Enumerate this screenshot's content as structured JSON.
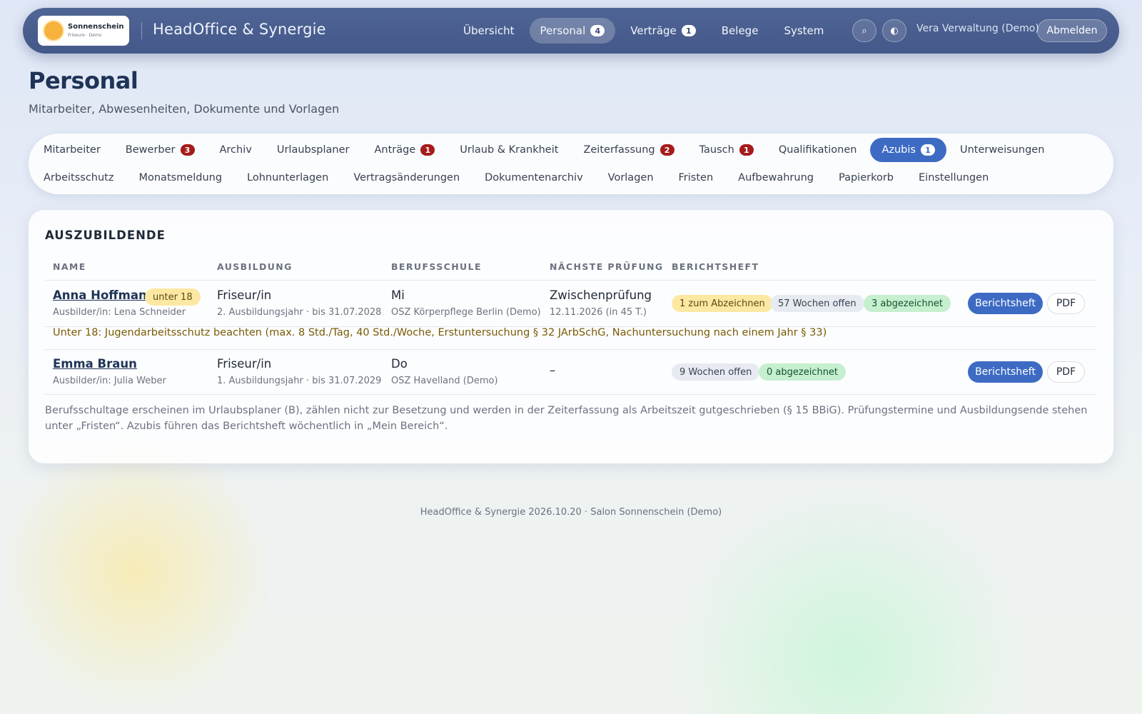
{
  "header": {
    "logo_name": "Sonnenschein",
    "logo_sub": "Friseure · Demo",
    "app_title": "HeadOffice & Synergie",
    "nav": [
      {
        "label": "Übersicht",
        "badge": ""
      },
      {
        "label": "Personal",
        "badge": "4",
        "active": true
      },
      {
        "label": "Verträge",
        "badge": "1"
      },
      {
        "label": "Belege",
        "badge": ""
      },
      {
        "label": "System",
        "badge": ""
      }
    ],
    "search_icon": "⌕",
    "theme_icon": "◐",
    "user": "Vera Verwaltung (Demo)",
    "logout_label": "Abmelden"
  },
  "page": {
    "title": "Personal",
    "subtitle": "Mitarbeiter, Abwesenheiten, Dokumente und Vorlagen"
  },
  "tabs": {
    "row1": [
      {
        "label": "Mitarbeiter",
        "badge": ""
      },
      {
        "label": "Bewerber",
        "badge": "3"
      },
      {
        "label": "Archiv",
        "badge": ""
      },
      {
        "label": "Urlaubsplaner",
        "badge": ""
      },
      {
        "label": "Anträge",
        "badge": "1"
      },
      {
        "label": "Urlaub & Krankheit",
        "badge": ""
      },
      {
        "label": "Zeiterfassung",
        "badge": "2"
      },
      {
        "label": "Tausch",
        "badge": "1"
      },
      {
        "label": "Qualifikationen",
        "badge": ""
      },
      {
        "label": "Azubis",
        "badge": "1",
        "active": true
      },
      {
        "label": "Unterweisungen",
        "badge": ""
      }
    ],
    "row2": [
      {
        "label": "Arbeitsschutz"
      },
      {
        "label": "Monatsmeldung"
      },
      {
        "label": "Lohnunterlagen"
      },
      {
        "label": "Vertragsänderungen"
      },
      {
        "label": "Dokumentenarchiv"
      },
      {
        "label": "Vorlagen"
      },
      {
        "label": "Fristen"
      },
      {
        "label": "Aufbewahrung"
      },
      {
        "label": "Papierkorb"
      },
      {
        "label": "Einstellungen"
      }
    ]
  },
  "card": {
    "title": "AUSZUBILDENDE",
    "columns": [
      "NAME",
      "AUSBILDUNG",
      "BERUFSSCHULE",
      "NÄCHSTE PRÜFUNG",
      "BERICHTSHEFT"
    ],
    "rows": [
      {
        "name": "Anna Hoffmann",
        "age_badge": "unter 18",
        "trainer": "Ausbilder/in: Lena Schneider",
        "training": "Friseur/in",
        "training_sub": "2. Ausbildungsjahr · bis 31.07.2028",
        "school_day": "Mi",
        "school": "OSZ Körperpflege Berlin (Demo)",
        "exam": "Zwischenprüfung",
        "exam_sub": "12.11.2026 (in 45 T.)",
        "pill_sign": "1 zum Abzeichnen",
        "pill_open": "57 Wochen offen",
        "pill_signed": "3 abgezeichnet",
        "btn_report": "Berichtsheft",
        "btn_pdf": "PDF"
      },
      {
        "name": "Emma Braun",
        "trainer": "Ausbilder/in: Julia Weber",
        "training": "Friseur/in",
        "training_sub": "1. Ausbildungsjahr · bis 31.07.2029",
        "school_day": "Do",
        "school": "OSZ Havelland (Demo)",
        "exam": "–",
        "pill_open": "9 Wochen offen",
        "pill_signed": "0 abgezeichnet",
        "btn_report": "Berichtsheft",
        "btn_pdf": "PDF"
      }
    ],
    "warning": "Unter 18: Jugendarbeitsschutz beachten (max. 8 Std./Tag, 40 Std./Woche, Erstuntersuchung § 32 JArbSchG, Nachuntersuchung nach einem Jahr § 33)",
    "note": "Berufsschultage erscheinen im Urlaubsplaner (B), zählen nicht zur Besetzung und werden in der Zeiterfassung als Arbeitszeit gutgeschrieben (§ 15 BBiG). Prüfungstermine und Ausbildungsende stehen unter „Fristen“. Azubis führen das Berichtsheft wöchentlich in „Mein Bereich“."
  },
  "footer": "HeadOffice & Synergie 2026.10.20 · Salon Sonnenschein (Demo)"
}
